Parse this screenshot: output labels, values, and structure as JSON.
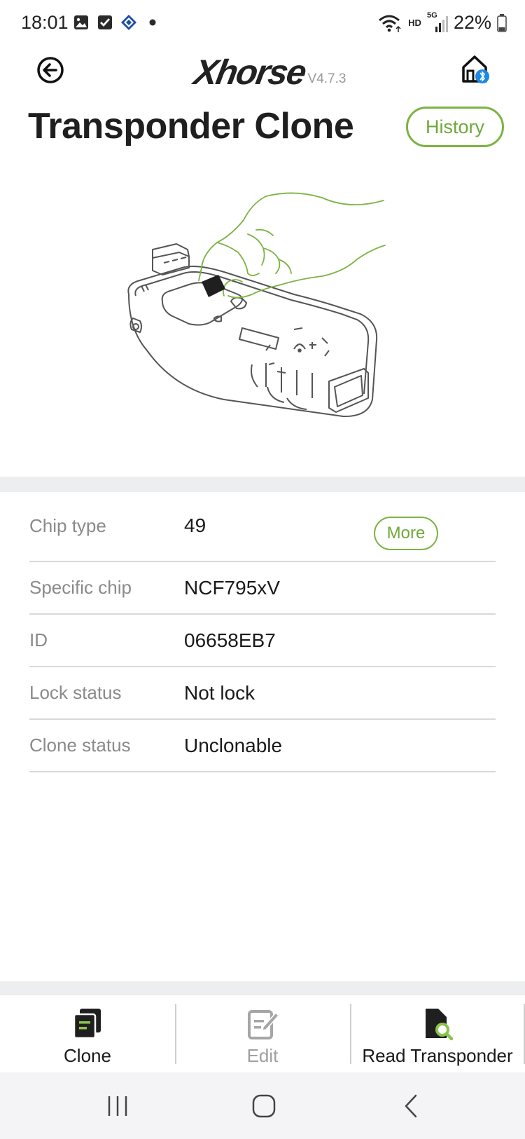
{
  "status_bar": {
    "time": "18:01",
    "battery": "22%",
    "network": "HD",
    "network_gen": "5G"
  },
  "header": {
    "logo_text": "Xhorse",
    "version": "V4.7.3"
  },
  "page": {
    "title": "Transponder Clone",
    "history_label": "History"
  },
  "info": {
    "rows": [
      {
        "label": "Chip type",
        "value": "49"
      },
      {
        "label": "Specific chip",
        "value": "NCF795xV"
      },
      {
        "label": "ID",
        "value": "06658EB7"
      },
      {
        "label": "Lock status",
        "value": "Not lock"
      },
      {
        "label": "Clone status",
        "value": "Unclonable"
      }
    ],
    "more_label": "More"
  },
  "tabs": [
    {
      "label": "Clone",
      "icon": "clone-icon",
      "enabled": true
    },
    {
      "label": "Edit",
      "icon": "edit-icon",
      "enabled": false
    },
    {
      "label": "Read Transponder",
      "icon": "read-transponder-icon",
      "enabled": true
    }
  ],
  "colors": {
    "accent": "#7cb342",
    "text": "#1a1a1a",
    "label": "#8a8a8a",
    "divider": "#d9d9d9",
    "band": "#eceef0"
  }
}
